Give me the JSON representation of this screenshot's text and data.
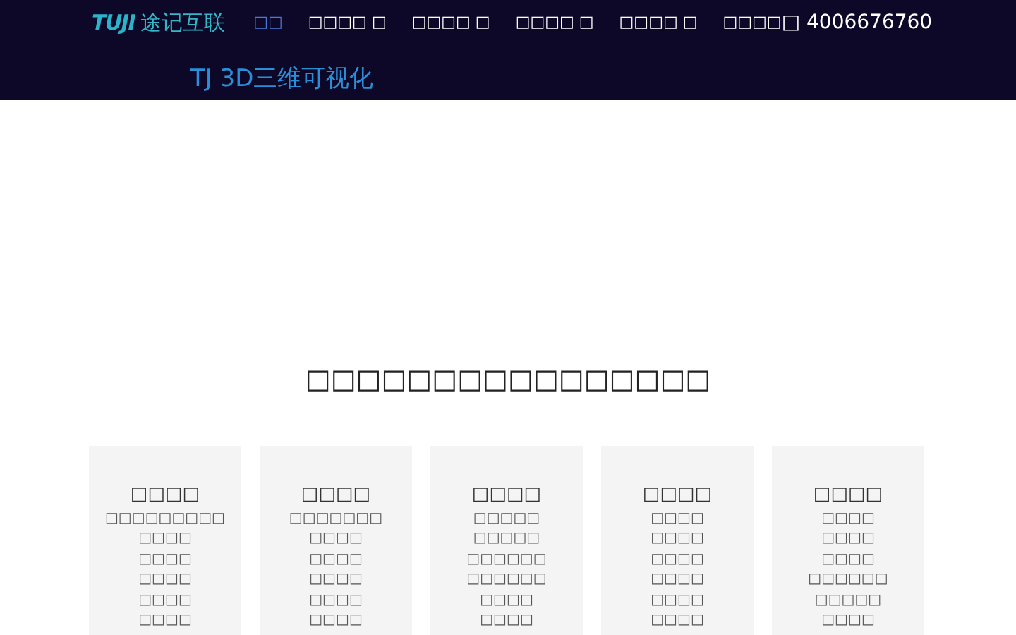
{
  "header": {
    "logo_mark": "TUJI",
    "logo_text": "途记互联",
    "nav": [
      {
        "label": "□□",
        "selected": true
      },
      {
        "label": "□□□□ □",
        "selected": false
      },
      {
        "label": "□□□□ □",
        "selected": false
      },
      {
        "label": "□□□□ □",
        "selected": false
      },
      {
        "label": "□□□□ □",
        "selected": false
      },
      {
        "label": "□□□□",
        "selected": false
      }
    ],
    "phone": "□ 4006676760"
  },
  "hero": {
    "title": "TJ 3D三维可视化"
  },
  "section": {
    "heading": "□□□□□□□□□□□□□□□□",
    "cards": [
      {
        "title": "□□□□",
        "items": [
          "□□□□□□□□□",
          "□□□□",
          "□□□□",
          "□□□□",
          "□□□□",
          "□□□□"
        ]
      },
      {
        "title": "□□□□",
        "items": [
          "□□□□□□□",
          "□□□□",
          "□□□□",
          "□□□□",
          "□□□□",
          "□□□□"
        ]
      },
      {
        "title": "□□□□",
        "items": [
          "□□□□□",
          "□□□□□",
          "□□□□□□",
          "□□□□□□",
          "□□□□",
          "□□□□"
        ]
      },
      {
        "title": "□□□□",
        "items": [
          "□□□□",
          "□□□□",
          "□□□□",
          "□□□□",
          "□□□□",
          "□□□□"
        ]
      },
      {
        "title": "□□□□",
        "items": [
          "□□□□",
          "□□□□",
          "□□□□",
          "□□□□□□",
          "□□□□□",
          "□□□□"
        ]
      }
    ]
  }
}
